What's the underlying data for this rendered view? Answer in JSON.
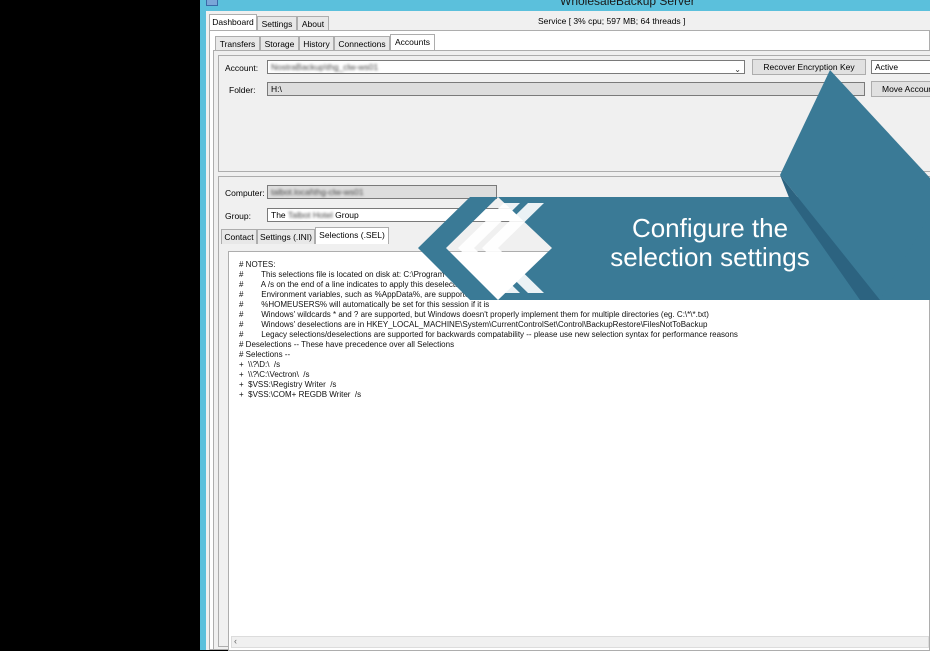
{
  "window": {
    "title": "WholesaleBackup Server"
  },
  "main_tabs": [
    "Dashboard",
    "Settings",
    "About"
  ],
  "service_status": "Service [  3% cpu; 597 MB; 64 threads ]",
  "sub_tabs": [
    "Transfers",
    "Storage",
    "History",
    "Connections",
    "Accounts"
  ],
  "account": {
    "label": "Account:",
    "value": "NostraBackup\\thg_clw-ws01",
    "recover_button": "Recover Encryption Key",
    "status": "Active",
    "folder_label": "Folder:",
    "folder_value": "H:\\",
    "move_button": "Move Account"
  },
  "details": {
    "computer_label": "Computer:",
    "computer_value": "talbot.local\\thg-clw-ws01",
    "group_label": "Group:",
    "group_prefix": "The",
    "group_blur": "Talbot Hotel",
    "group_suffix": "Group"
  },
  "detail_tabs": [
    "Contact",
    "Settings (.INI)",
    "Selections (.SEL)"
  ],
  "selections_lines": [
    "# NOTES:",
    "#        This selections file is located on disk at: C:\\Program Files",
    "#        A /s on the end of a line indicates to apply this deselection",
    "#        Environment variables, such as %AppData%, are supported",
    "#        %HOMEUSERS% will automatically be set for this session if it is",
    "#        Windows' wildcards * and ? are supported, but Windows doesn't properly implement them for multiple directories (eg. C:\\*\\*.txt)",
    "#        Windows' deselections are in HKEY_LOCAL_MACHINE\\System\\CurrentControlSet\\Control\\BackupRestore\\FilesNotToBackup",
    "#        Legacy selections/deselections are supported for backwards compatability -- please use new selection syntax for performance reasons",
    "# Deselections -- These have precedence over all Selections",
    "# Selections --",
    "+  \\\\?\\D:\\  /s",
    "+  \\\\?\\C:\\Vectron\\  /s",
    "+  $VSS:\\Registry Writer  /s",
    "+  $VSS:\\COM+ REGDB Writer  /s"
  ],
  "callout": {
    "line1": "Configure the",
    "line2": "selection settings",
    "color": "#3a7a96"
  },
  "icons": {
    "scroll_left": "chevron-left-icon",
    "dropdown": "chevron-down-icon",
    "app": "app-icon"
  }
}
